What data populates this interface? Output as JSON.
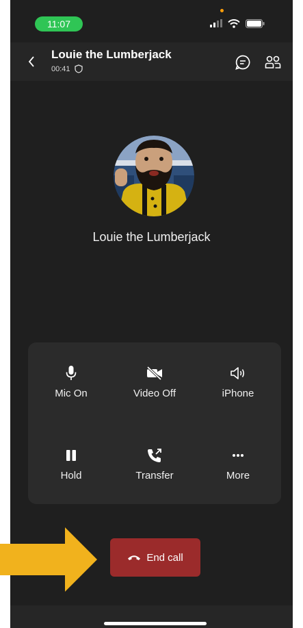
{
  "status_bar": {
    "time": "11:07"
  },
  "header": {
    "contact_name": "Louie the Lumberjack",
    "duration": "00:41"
  },
  "callee": {
    "name": "Louie the Lumberjack"
  },
  "controls": [
    {
      "label": "Mic On",
      "icon": "microphone-icon"
    },
    {
      "label": "Video Off",
      "icon": "video-off-icon"
    },
    {
      "label": "iPhone",
      "icon": "speaker-icon"
    },
    {
      "label": "Hold",
      "icon": "pause-icon"
    },
    {
      "label": "Transfer",
      "icon": "transfer-call-icon"
    },
    {
      "label": "More",
      "icon": "more-icon"
    }
  ],
  "end_call": {
    "label": "End call",
    "icon": "hang-up-icon"
  },
  "colors": {
    "background": "#1f1f1f",
    "panel": "#2b2b2b",
    "end_call": "#9b2b2b",
    "time_pill": "#2fc555",
    "annotation_arrow": "#f1b21d"
  }
}
